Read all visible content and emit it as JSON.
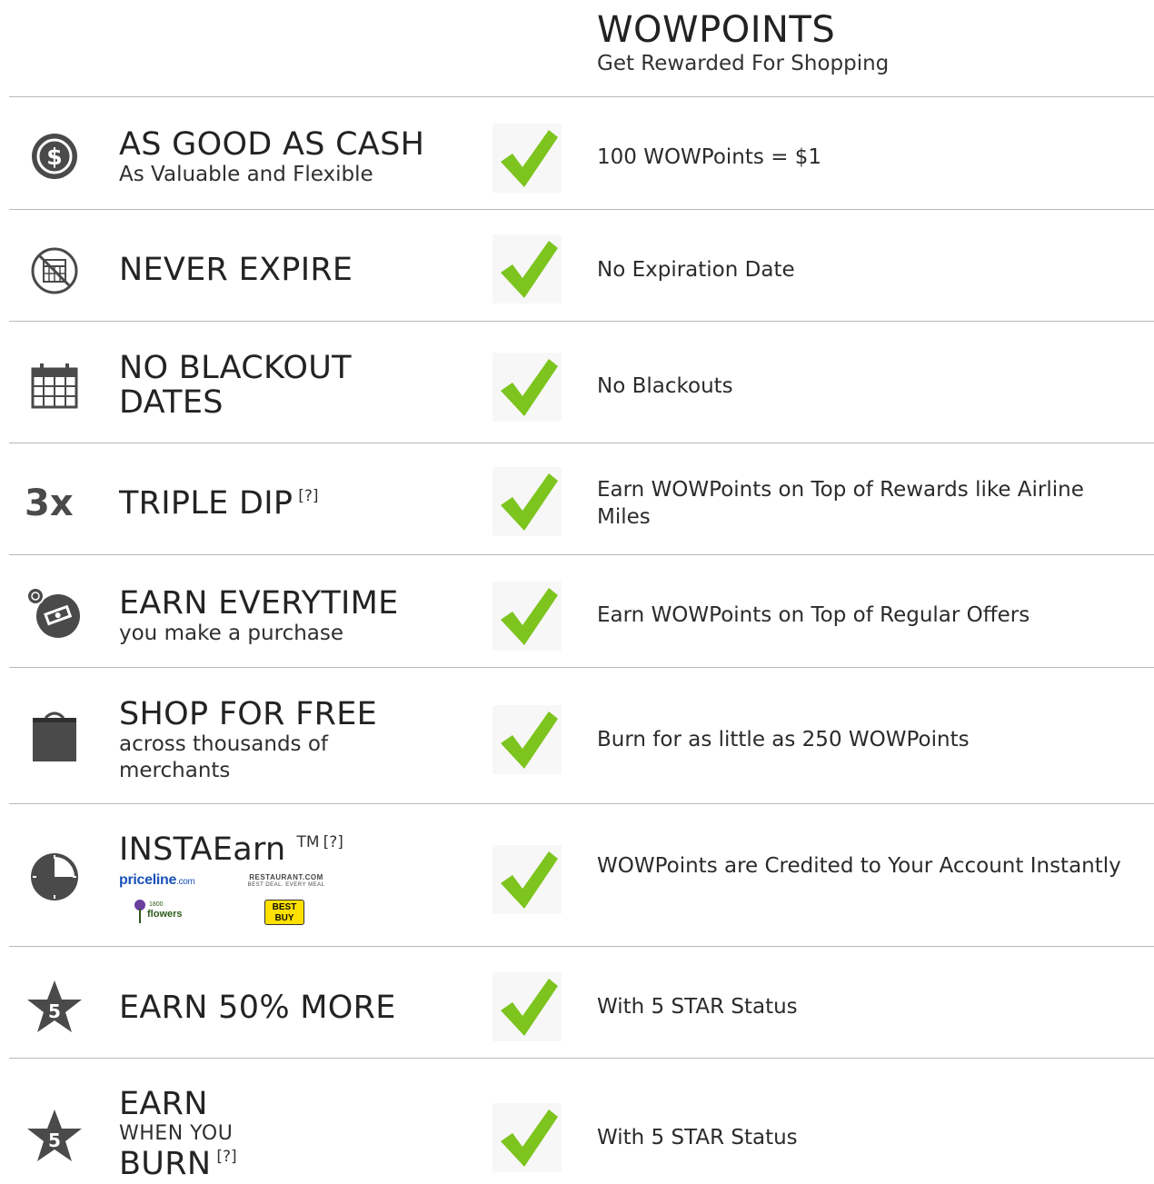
{
  "header": {
    "title": "WOWPOINTS",
    "subtitle": "Get Rewarded For Shopping"
  },
  "help_marker": "[?]",
  "rows": [
    {
      "icon": "dollar-coin-icon",
      "title": "AS GOOD AS CASH",
      "subtitle": "As Valuable and Flexible",
      "description": "100 WOWPoints = $1",
      "checked": true
    },
    {
      "icon": "no-expiration-calendar-icon",
      "title": "NEVER EXPIRE",
      "description": "No Expiration Date",
      "checked": true
    },
    {
      "icon": "calendar-icon",
      "title_line1": "NO BLACKOUT",
      "title_line2": "DATES",
      "description": "No Blackouts",
      "checked": true
    },
    {
      "icon_text": "3x",
      "title": "TRIPLE DIP",
      "description": "Earn WOWPoints on Top of Rewards like Airline Miles",
      "checked": true
    },
    {
      "icon": "cash-stack-icon",
      "title": "EARN EVERYTIME",
      "subtitle": "you make a purchase",
      "description": "Earn WOWPoints on Top of Regular Offers",
      "checked": true
    },
    {
      "icon": "shopping-bag-icon",
      "title": "SHOP FOR FREE",
      "subtitle_line1": "across thousands of",
      "subtitle_line2": "merchants",
      "description": "Burn for as little as 250 WOWPoints",
      "checked": true
    },
    {
      "icon": "clock-icon",
      "title": "INSTAEarn",
      "trademark": "TM",
      "description": "WOWPoints are Credited to Your Account Instantly",
      "checked": true,
      "logos": {
        "priceline": "priceline",
        "priceline_suffix": ".com",
        "restaurant": "RESTAURANT.COM",
        "restaurant_tag": "BEST DEAL. EVERY MEAL",
        "flowers_num": "1800",
        "flowers": "flowers",
        "bestbuy_1": "BEST",
        "bestbuy_2": "BUY"
      }
    },
    {
      "icon": "five-star-badge-icon",
      "badge_number": "5",
      "title": "EARN 50% MORE",
      "description": "With 5 STAR Status",
      "checked": true
    },
    {
      "icon": "five-star-badge-icon",
      "badge_number": "5",
      "title_line1": "EARN",
      "title_line2": "WHEN YOU",
      "title_line3": "BURN",
      "description": "With 5 STAR Status",
      "checked": true
    }
  ],
  "colors": {
    "check": "#7dc41f",
    "icon": "#4a4a4a",
    "divider": "#b9b9b9"
  }
}
